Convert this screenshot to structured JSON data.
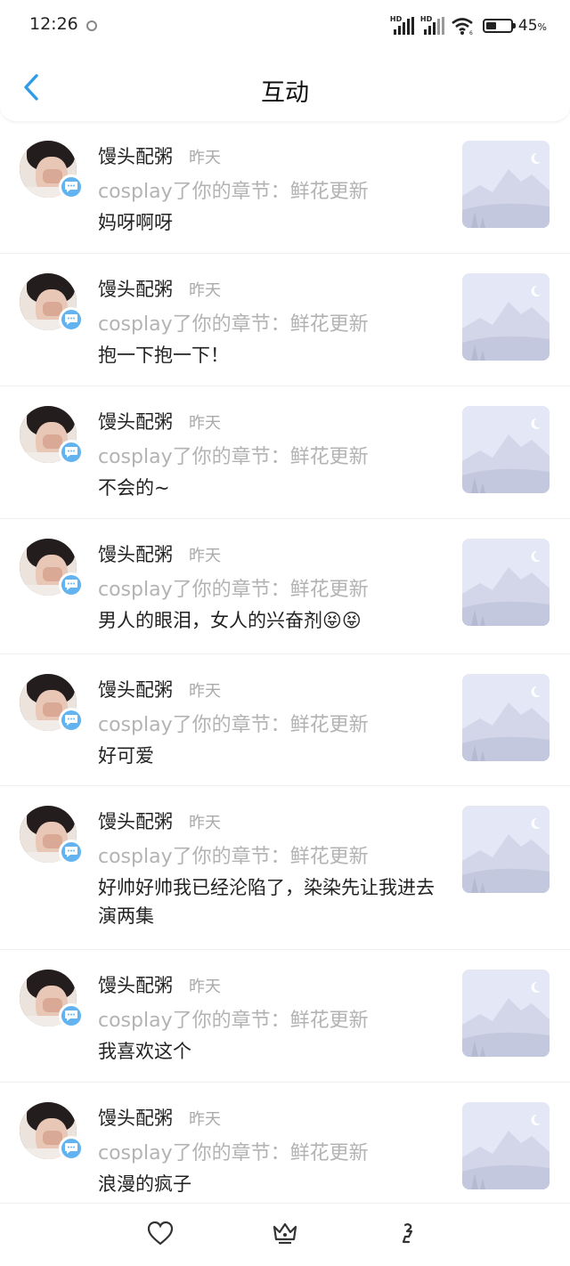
{
  "status_bar": {
    "time": "12:26",
    "signal_1": "HD",
    "signal_2": "HD",
    "wifi_level": "6",
    "battery": "45",
    "battery_unit": "%"
  },
  "header": {
    "title": "互动",
    "back_icon": "chevron-left-icon",
    "accent": "#2f9be9"
  },
  "items": [
    {
      "user": "馒头配粥",
      "time": "昨天",
      "action": "cosplay了你的章节：鲜花更新",
      "comment": "妈呀啊呀"
    },
    {
      "user": "馒头配粥",
      "time": "昨天",
      "action": "cosplay了你的章节：鲜花更新",
      "comment": "抱一下抱一下！"
    },
    {
      "user": "馒头配粥",
      "time": "昨天",
      "action": "cosplay了你的章节：鲜花更新",
      "comment": "不会的~"
    },
    {
      "user": "馒头配粥",
      "time": "昨天",
      "action": "cosplay了你的章节：鲜花更新",
      "comment": "男人的眼泪，女人的兴奋剂😝😝"
    },
    {
      "user": "馒头配粥",
      "time": "昨天",
      "action": "cosplay了你的章节：鲜花更新",
      "comment": "好可爱"
    },
    {
      "user": "馒头配粥",
      "time": "昨天",
      "action": "cosplay了你的章节：鲜花更新",
      "comment": "好帅好帅我已经沦陷了，染染先让我进去演两集"
    },
    {
      "user": "馒头配粥",
      "time": "昨天",
      "action": "cosplay了你的章节：鲜花更新",
      "comment": "我喜欢这个"
    },
    {
      "user": "馒头配粥",
      "time": "昨天",
      "action": "cosplay了你的章节：鲜花更新",
      "comment": "浪漫的疯子"
    }
  ],
  "colors": {
    "badge": "#62b3f0",
    "muted_text": "#b3b3b3",
    "thumbnail_bg": "#e4e7f5"
  },
  "bottom_bar": {
    "icons": [
      "heart-icon",
      "crown-icon",
      "gesture-icon"
    ]
  }
}
